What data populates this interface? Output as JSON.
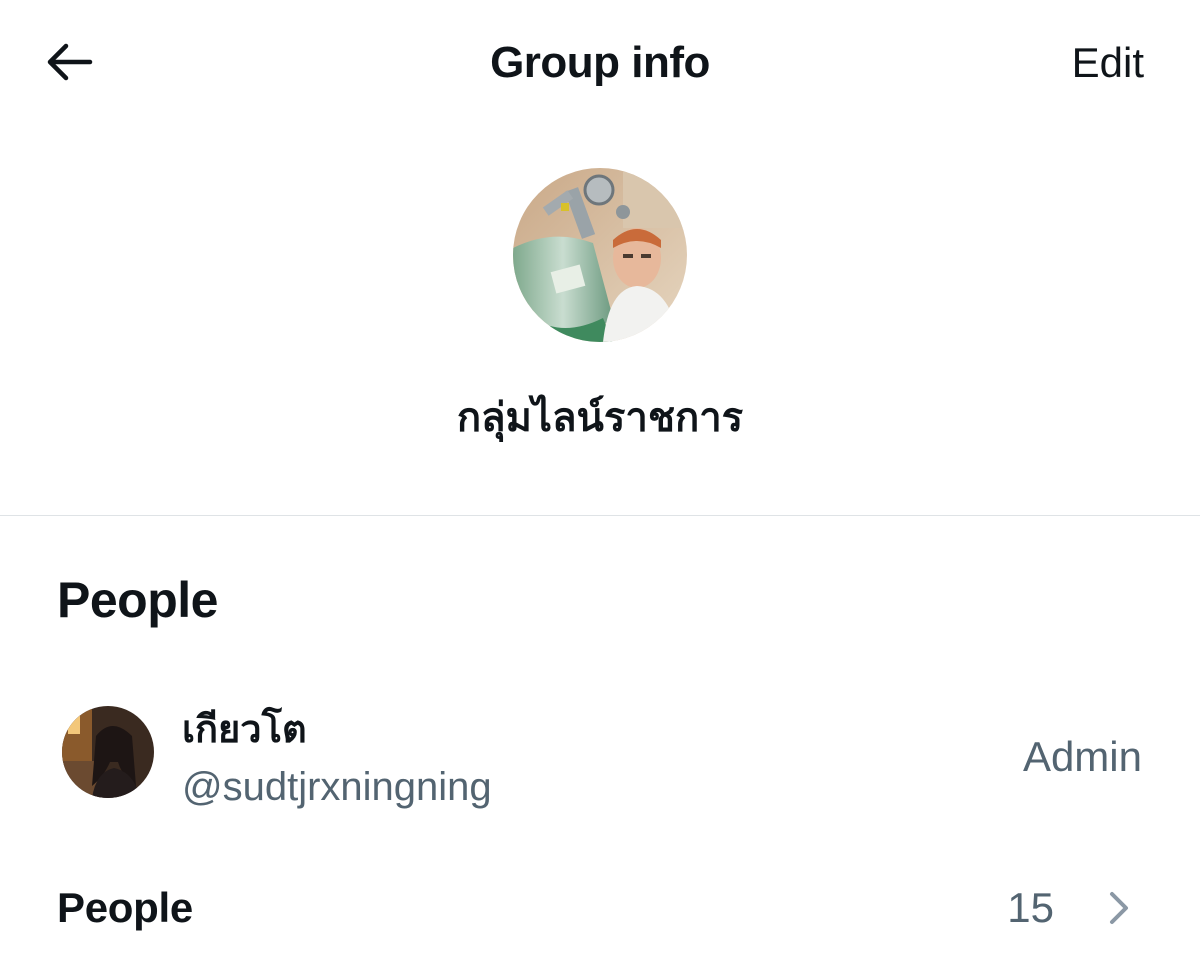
{
  "header": {
    "title": "Group info",
    "edit_label": "Edit",
    "back_icon": "arrow-left-icon"
  },
  "group": {
    "name": "กลุ่มไลน์ราชการ",
    "avatar": "group-avatar-photo"
  },
  "people_section": {
    "title": "People",
    "members": [
      {
        "name": "เกียวโต",
        "handle": "@sudtjrxningning",
        "role": "Admin"
      }
    ],
    "all_people_label": "People",
    "count": "15",
    "chevron_icon": "chevron-right-icon"
  },
  "colors": {
    "primary_text": "#0f1419",
    "secondary_text": "#536471",
    "divider": "#dfe3e6",
    "background": "#ffffff"
  }
}
